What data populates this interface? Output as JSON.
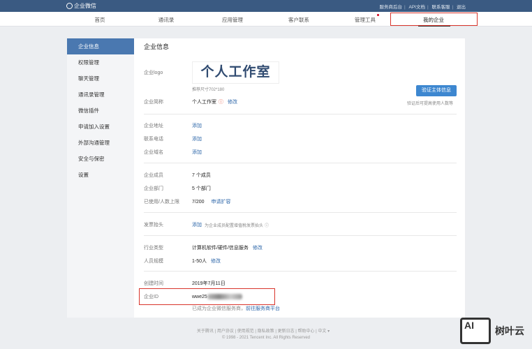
{
  "topbar": {
    "brand": "企业微信",
    "links": [
      "服务商后台",
      "API文档",
      "联系客服",
      "退出"
    ]
  },
  "nav": {
    "items": [
      "首页",
      "通讯录",
      "应用管理",
      "客户联系",
      "管理工具",
      "我的企业"
    ]
  },
  "sidebar": {
    "items": [
      "企业信息",
      "权限管理",
      "聊天管理",
      "通讯录管理",
      "微信插件",
      "申请加入设置",
      "外部沟通管理",
      "安全与保密",
      "设置"
    ]
  },
  "main": {
    "title": "企业信息",
    "logo_label": "企业logo",
    "logo_text": "个人工作室",
    "logo_hint": "推荐尺寸702*180",
    "verify_button": "验证主体信息",
    "verify_hint": "验证后可提高使用人数等",
    "short_name_label": "企业简称",
    "short_name": "个人工作室",
    "modify": "修改",
    "address_label": "企业地址",
    "phone_label": "联系电话",
    "domain_label": "企业域名",
    "add": "添加",
    "members_label": "企业成员",
    "members": "7 个成员",
    "depts_label": "企业部门",
    "depts": "5 个部门",
    "limit_label": "已使用/人数上限",
    "limit": "7/200",
    "expand": "申请扩容",
    "invoice_label": "发票抬头",
    "invoice_hint": "为企业成员配置增值税发票抬头",
    "industry_label": "行业类型",
    "industry": "计算机软件/硬件/信息服务",
    "scale_label": "人员规模",
    "scale": "1-50人",
    "created_label": "创建时间",
    "created": "2019年7月11日",
    "id_label": "企业ID",
    "id_prefix": "wwe25",
    "provider_note": "已成为企业微信服务商，",
    "provider_link": "前往服务商平台"
  },
  "footer": {
    "links": [
      "关于腾讯",
      "用户协议",
      "使用规范",
      "隐私政策",
      "更新日志",
      "帮助中心",
      "中文 ▾"
    ],
    "copyright": "© 1998 - 2021 Tencent Inc. All Rights Reserved"
  },
  "watermark": {
    "logo": "AI",
    "text": "树叶云"
  }
}
